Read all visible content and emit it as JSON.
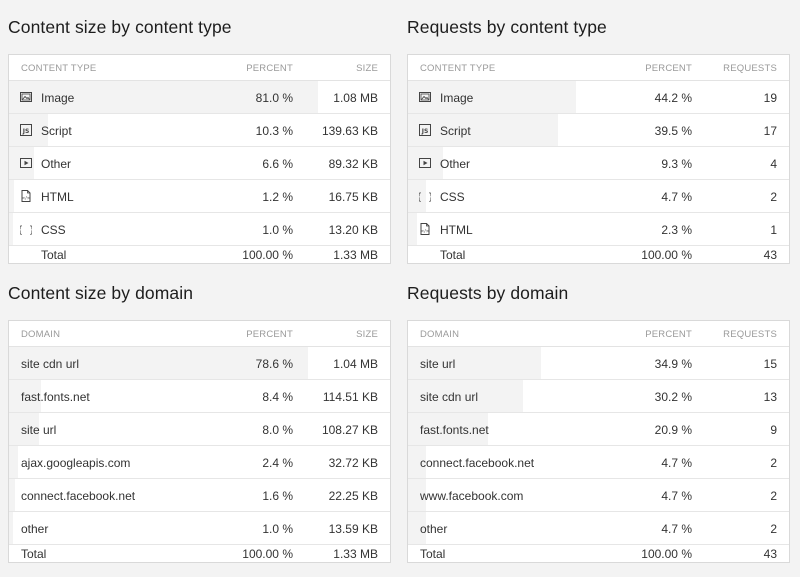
{
  "panels": [
    {
      "title": "Content size by content type",
      "columns": [
        "Content type",
        "Percent",
        "Size"
      ],
      "rows": [
        {
          "icon": "image-icon",
          "name": "Image",
          "percent": "81.0 %",
          "value": "1.08 MB",
          "fraction": 0.81
        },
        {
          "icon": "script-icon",
          "name": "Script",
          "percent": "10.3 %",
          "value": "139.63 KB",
          "fraction": 0.103
        },
        {
          "icon": "video-icon",
          "name": "Other",
          "percent": "6.6 %",
          "value": "89.32 KB",
          "fraction": 0.066
        },
        {
          "icon": "html-file-icon",
          "name": "HTML",
          "percent": "1.2 %",
          "value": "16.75 KB",
          "fraction": 0.012
        },
        {
          "icon": "css-braces-icon",
          "name": "CSS",
          "percent": "1.0 %",
          "value": "13.20 KB",
          "fraction": 0.01
        }
      ],
      "total": {
        "name": "Total",
        "percent": "100.00 %",
        "value": "1.33 MB"
      }
    },
    {
      "title": "Requests by content type",
      "columns": [
        "Content type",
        "Percent",
        "Requests"
      ],
      "rows": [
        {
          "icon": "image-icon",
          "name": "Image",
          "percent": "44.2 %",
          "value": "19",
          "fraction": 0.442
        },
        {
          "icon": "script-icon",
          "name": "Script",
          "percent": "39.5 %",
          "value": "17",
          "fraction": 0.395
        },
        {
          "icon": "video-icon",
          "name": "Other",
          "percent": "9.3 %",
          "value": "4",
          "fraction": 0.093
        },
        {
          "icon": "css-braces-icon",
          "name": "CSS",
          "percent": "4.7 %",
          "value": "2",
          "fraction": 0.047
        },
        {
          "icon": "html-file-icon",
          "name": "HTML",
          "percent": "2.3 %",
          "value": "1",
          "fraction": 0.023
        }
      ],
      "total": {
        "name": "Total",
        "percent": "100.00 %",
        "value": "43"
      }
    },
    {
      "title": "Content size by domain",
      "columns": [
        "Domain",
        "Percent",
        "Size"
      ],
      "rows": [
        {
          "name": "site cdn url",
          "percent": "78.6 %",
          "value": "1.04 MB",
          "fraction": 0.786
        },
        {
          "name": "fast.fonts.net",
          "percent": "8.4 %",
          "value": "114.51 KB",
          "fraction": 0.084
        },
        {
          "name": "site url",
          "percent": "8.0 %",
          "value": "108.27 KB",
          "fraction": 0.08
        },
        {
          "name": "ajax.googleapis.com",
          "percent": "2.4 %",
          "value": "32.72 KB",
          "fraction": 0.024
        },
        {
          "name": "connect.facebook.net",
          "percent": "1.6 %",
          "value": "22.25 KB",
          "fraction": 0.016
        },
        {
          "name": "other",
          "percent": "1.0 %",
          "value": "13.59 KB",
          "fraction": 0.01
        }
      ],
      "total": {
        "name": "Total",
        "percent": "100.00 %",
        "value": "1.33 MB"
      }
    },
    {
      "title": "Requests by domain",
      "columns": [
        "Domain",
        "Percent",
        "Requests"
      ],
      "rows": [
        {
          "name": "site url",
          "percent": "34.9 %",
          "value": "15",
          "fraction": 0.349
        },
        {
          "name": "site cdn url",
          "percent": "30.2 %",
          "value": "13",
          "fraction": 0.302
        },
        {
          "name": "fast.fonts.net",
          "percent": "20.9 %",
          "value": "9",
          "fraction": 0.209
        },
        {
          "name": "connect.facebook.net",
          "percent": "4.7 %",
          "value": "2",
          "fraction": 0.047
        },
        {
          "name": "www.facebook.com",
          "percent": "4.7 %",
          "value": "2",
          "fraction": 0.047
        },
        {
          "name": "other",
          "percent": "4.7 %",
          "value": "2",
          "fraction": 0.047
        }
      ],
      "total": {
        "name": "Total",
        "percent": "100.00 %",
        "value": "43"
      }
    }
  ]
}
